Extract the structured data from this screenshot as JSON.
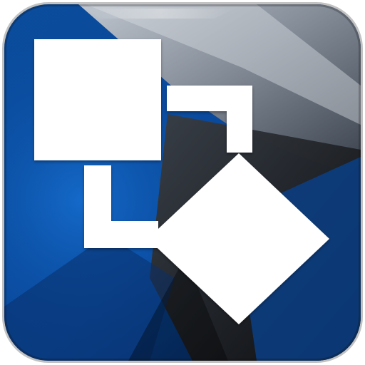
{
  "app_icon": {
    "icon_name": "shape-transform-icon",
    "colors": {
      "brand_blue": "#0a4fa0",
      "deep_blue": "#062a66",
      "dark_gray": "#2a2d33",
      "mid_gray": "#6b7078",
      "light_gray": "#c7cbd1",
      "black": "#0b0b0c",
      "white": "#ffffff"
    }
  }
}
